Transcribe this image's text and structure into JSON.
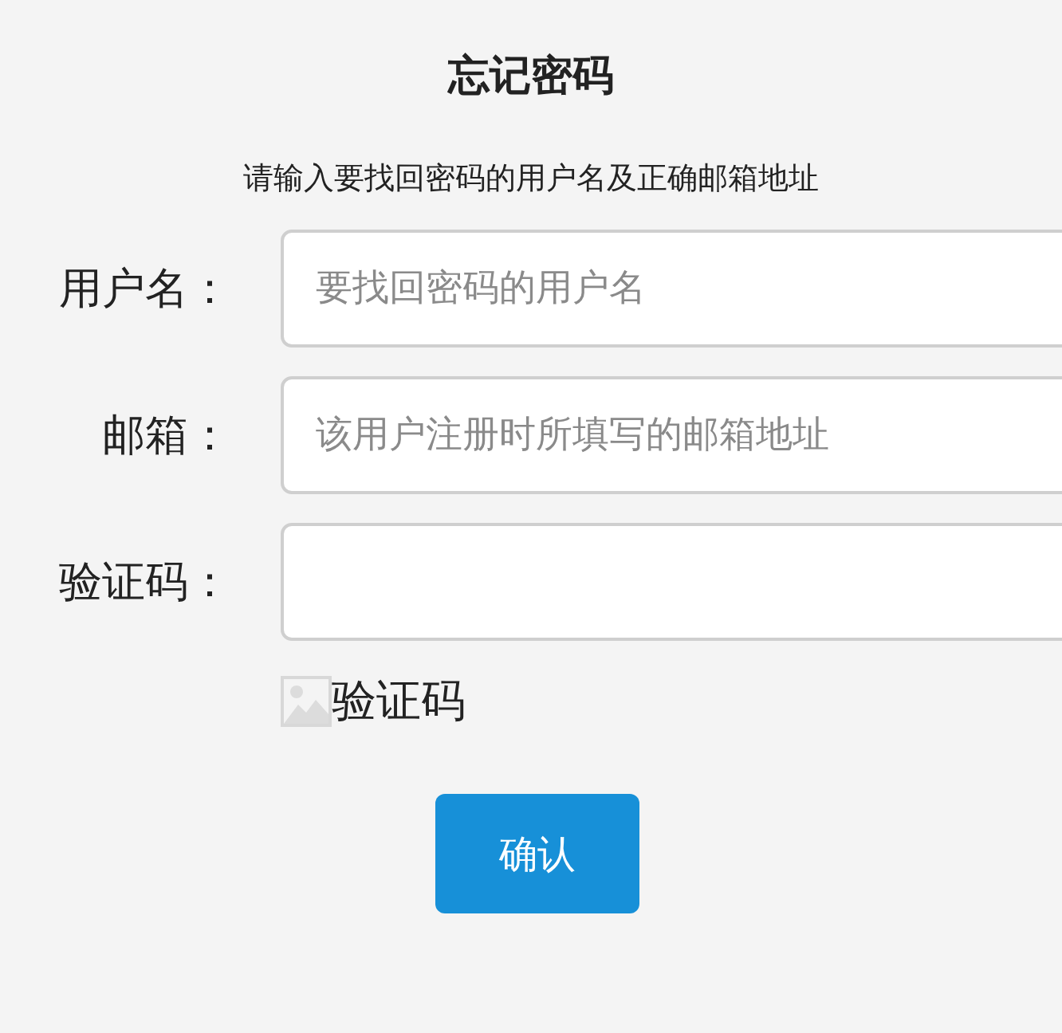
{
  "title": "忘记密码",
  "instructions": "请输入要找回密码的用户名及正确邮箱地址",
  "fields": [
    {
      "label": "用户名：",
      "placeholder": "要找回密码的用户名"
    },
    {
      "label": "邮箱：",
      "placeholder": "该用户注册时所填写的邮箱地址"
    },
    {
      "label": "验证码："
    }
  ],
  "captcha": {
    "alt_text": "验证码"
  },
  "buttons": [
    "确认"
  ]
}
